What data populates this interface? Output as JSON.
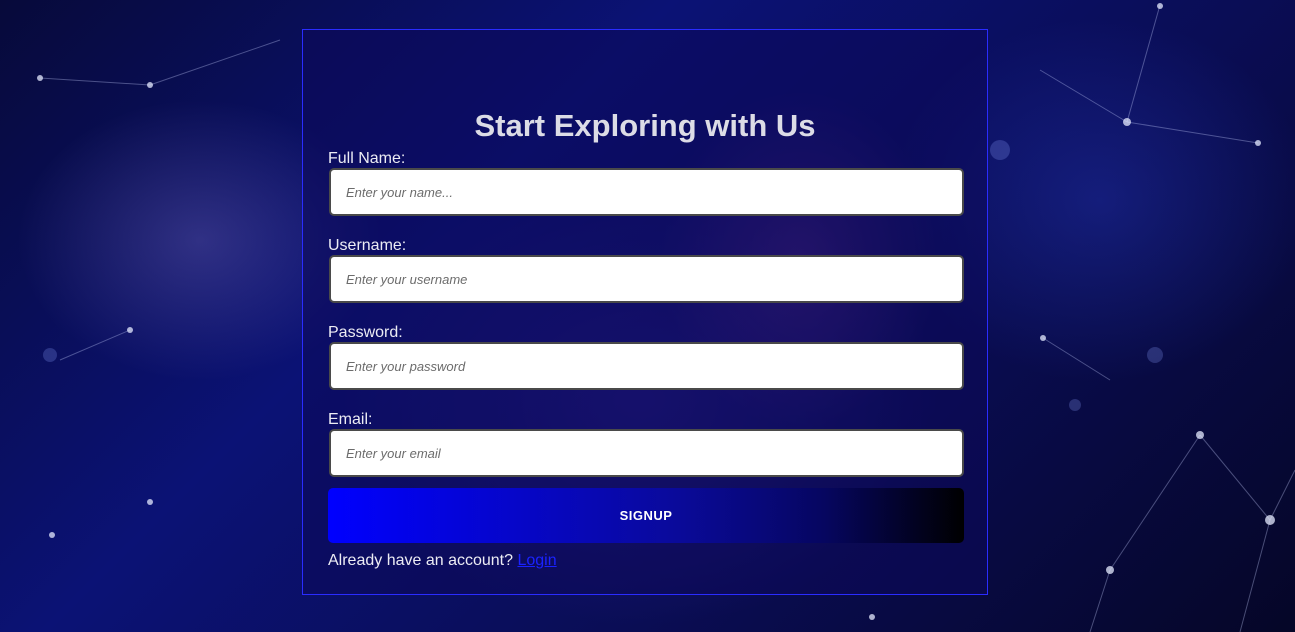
{
  "form": {
    "title": "Start Exploring with Us",
    "fields": [
      {
        "label": "Full Name:",
        "placeholder": "Enter your name...",
        "value": ""
      },
      {
        "label": "Username:",
        "placeholder": "Enter your username",
        "value": ""
      },
      {
        "label": "Password:",
        "placeholder": "Enter your password",
        "value": ""
      },
      {
        "label": "Email:",
        "placeholder": "Enter your email",
        "value": ""
      }
    ],
    "submit_label": "SIGNUP",
    "footer_text": "Already have an account?",
    "login_link": "Login"
  },
  "colors": {
    "button_gradient_start": "#0000ff",
    "button_gradient_end": "#000000",
    "link": "#1a22ff",
    "card_border": "#2a2cff",
    "background": "#0b1275"
  }
}
